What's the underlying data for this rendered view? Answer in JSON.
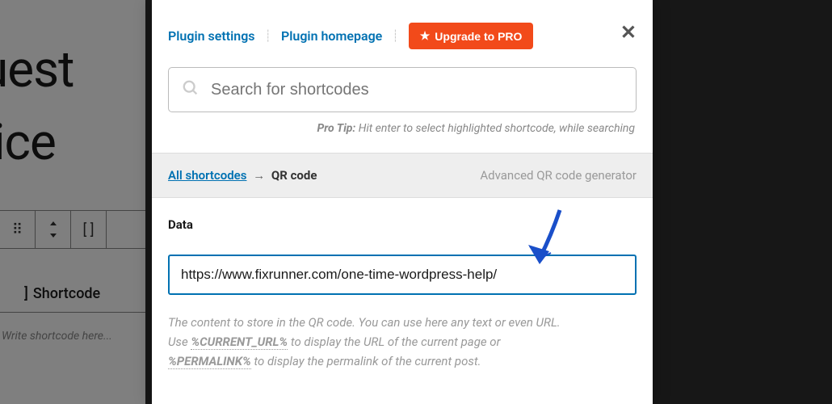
{
  "background": {
    "titleLine1": "equest",
    "titleLine2": "ervice",
    "shortcodeLabel": "Shortcode",
    "shortcodePlaceholder": "Write shortcode here..."
  },
  "header": {
    "pluginSettings": "Plugin settings",
    "pluginHomepage": "Plugin homepage",
    "upgradeLabel": "Upgrade to PRO"
  },
  "search": {
    "placeholder": "Search for shortcodes"
  },
  "proTip": {
    "prefix": "Pro Tip:",
    "text": " Hit enter to select highlighted shortcode, while searching"
  },
  "breadcrumb": {
    "allShortcodes": "All shortcodes",
    "arrow": "→",
    "current": "QR code",
    "description": "Advanced QR code generator"
  },
  "form": {
    "dataLabel": "Data",
    "dataValue": "https://www.fixrunner.com/one-time-wordpress-help/",
    "help1": "The content to store in the QR code. You can use here any text or even URL.",
    "help2a": "Use ",
    "help2token": "%CURRENT_URL%",
    "help2b": " to display the URL of the current page or ",
    "help3token": "%PERMALINK%",
    "help3b": " to display the permalink of the current post."
  }
}
